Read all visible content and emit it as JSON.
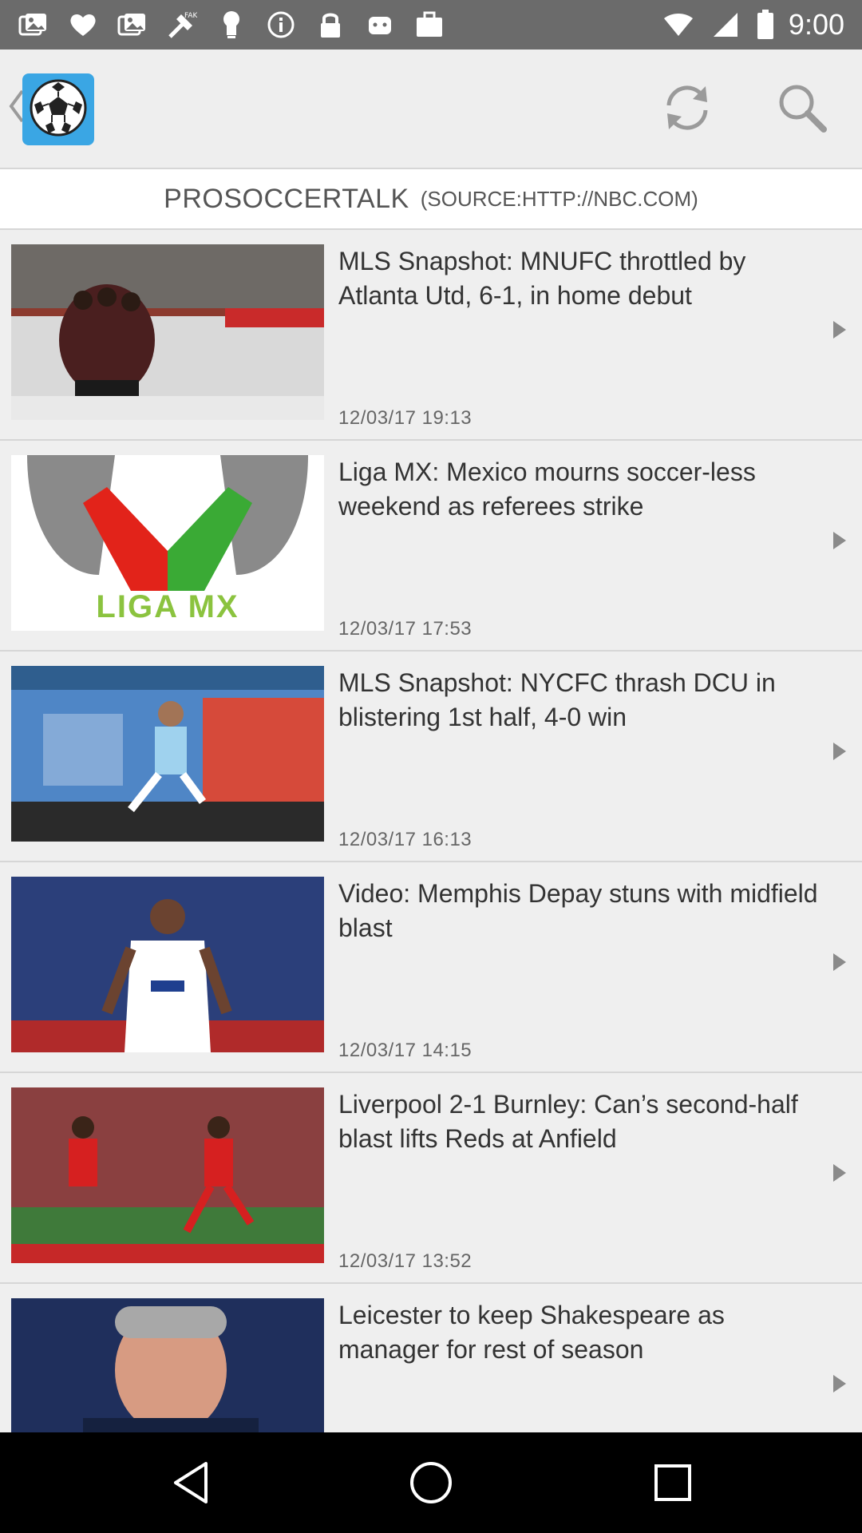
{
  "status_bar": {
    "time": "9:00",
    "icons": [
      "photos-icon",
      "heart-icon",
      "photos-icon",
      "fake-gps-icon",
      "bulb-icon",
      "info-icon",
      "lock-icon",
      "android-icon",
      "briefcase-icon"
    ]
  },
  "app_bar": {
    "logo": "soccer-ball-icon",
    "actions": [
      "refresh-icon",
      "search-icon"
    ]
  },
  "source_header": {
    "name": "PROSOCCERTALK",
    "url": "(SOURCE:HTTP://NBC.COM)"
  },
  "articles": [
    {
      "headline": "MLS Snapshot: MNUFC throttled by Atlanta Utd, 6-1, in home debut",
      "date": "12/03/17 19:13"
    },
    {
      "headline": "Liga MX: Mexico mourns soccer-less weekend as referees strike",
      "date": "12/03/17 17:53",
      "thumb_text": "LIGA MX"
    },
    {
      "headline": "MLS Snapshot: NYCFC thrash DCU in blistering 1st half, 4-0 win",
      "date": "12/03/17 16:13"
    },
    {
      "headline": "Video: Memphis Depay stuns with midfield blast",
      "date": "12/03/17 14:15"
    },
    {
      "headline": "Liverpool 2-1 Burnley: Can’s second-half blast lifts Reds at Anfield",
      "date": "12/03/17 13:52"
    },
    {
      "headline": "Leicester to keep Shakespeare as manager for rest of season",
      "date": ""
    }
  ],
  "nav_bar": {
    "buttons": [
      "back-icon",
      "home-icon",
      "recents-icon"
    ]
  },
  "colors": {
    "status_bar": "#6b6b6b",
    "app_bar": "#eeeeee",
    "list_bg": "#efefef",
    "logo_bg": "#3aa6e4",
    "nav_bar": "#000000"
  }
}
